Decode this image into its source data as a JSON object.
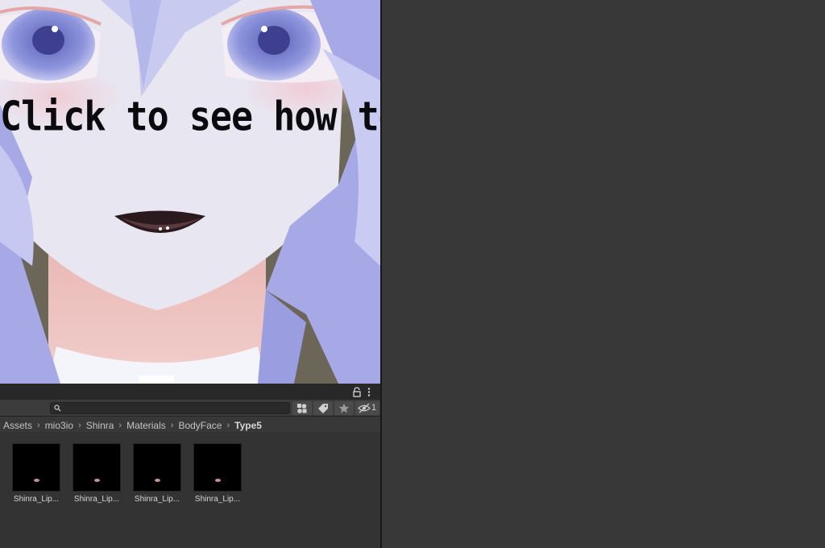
{
  "preview": {
    "caption": "Click to see how to use"
  },
  "project_panel": {
    "search": {
      "value": "",
      "placeholder": ""
    },
    "hidden_packages_count": "1",
    "breadcrumb": [
      {
        "label": "Assets"
      },
      {
        "label": "mio3io"
      },
      {
        "label": "Shinra"
      },
      {
        "label": "Materials"
      },
      {
        "label": "BodyFace"
      }
    ],
    "breadcrumb_current": "Type5",
    "assets": [
      {
        "label": "Shinra_Lip..."
      },
      {
        "label": "Shinra_Lip..."
      },
      {
        "label": "Shinra_Lip..."
      },
      {
        "label": "Shinra_Lip..."
      }
    ]
  },
  "colors": {
    "panel_bg": "#383838",
    "header_bg": "#282828",
    "thumbnail_bg": "#000000",
    "hair": "#a7a9e6",
    "skin": "#e7e5ef"
  }
}
